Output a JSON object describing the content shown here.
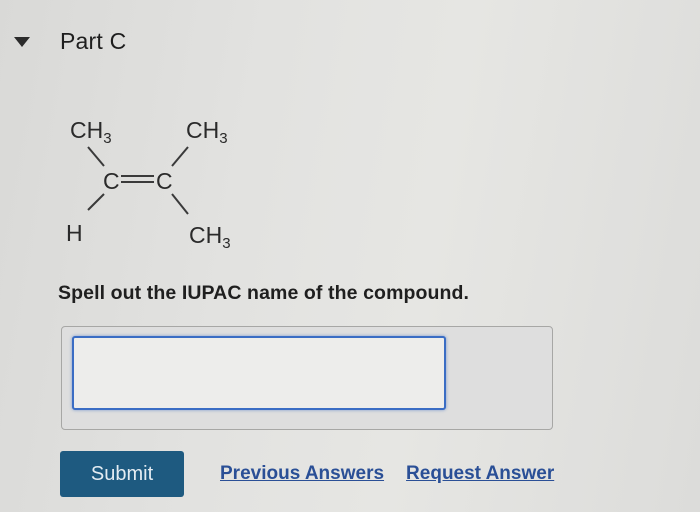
{
  "part": {
    "title": "Part C",
    "collapse_icon": "caret-down-icon"
  },
  "structure": {
    "top_left": "CH",
    "top_right": "CH",
    "bottom_left": "H",
    "bottom_right": "CH",
    "subscript": "3",
    "center": "C=C",
    "double_bond": "="
  },
  "question": {
    "prompt": "Spell out the IUPAC name of the compound."
  },
  "answer": {
    "value": "",
    "placeholder": ""
  },
  "actions": {
    "submit_label": "Submit",
    "previous_answers_label": "Previous Answers",
    "request_answer_label": "Request Answer"
  },
  "colors": {
    "submit_bg": "#1e5a80",
    "input_border": "#3a6dc4",
    "link": "#2a4f96"
  }
}
